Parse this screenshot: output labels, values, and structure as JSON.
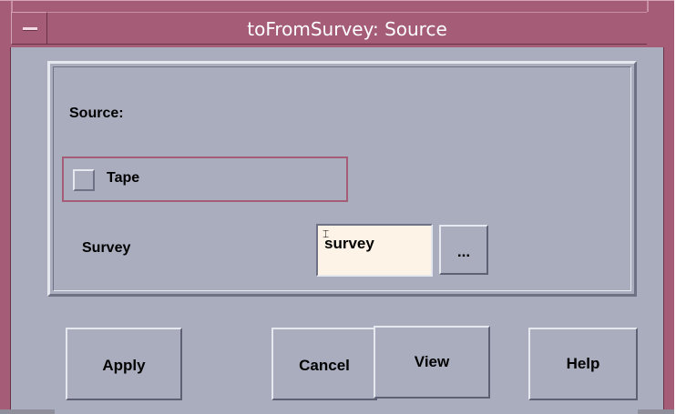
{
  "window": {
    "title": "toFromSurvey: Source"
  },
  "source_panel": {
    "source_label": "Source:",
    "tape_label": "Tape",
    "tape_checked": false,
    "survey_label": "Survey",
    "survey_value": "survey",
    "browse_label": "..."
  },
  "buttons": {
    "apply": "Apply",
    "cancel": "Cancel",
    "view": "View",
    "help": "Help"
  },
  "colors": {
    "titlebar": "#a45c77",
    "background": "#a9adbe",
    "input_background": "#fdf3e6"
  },
  "icons": {
    "window_menu": "window-menu-icon"
  }
}
